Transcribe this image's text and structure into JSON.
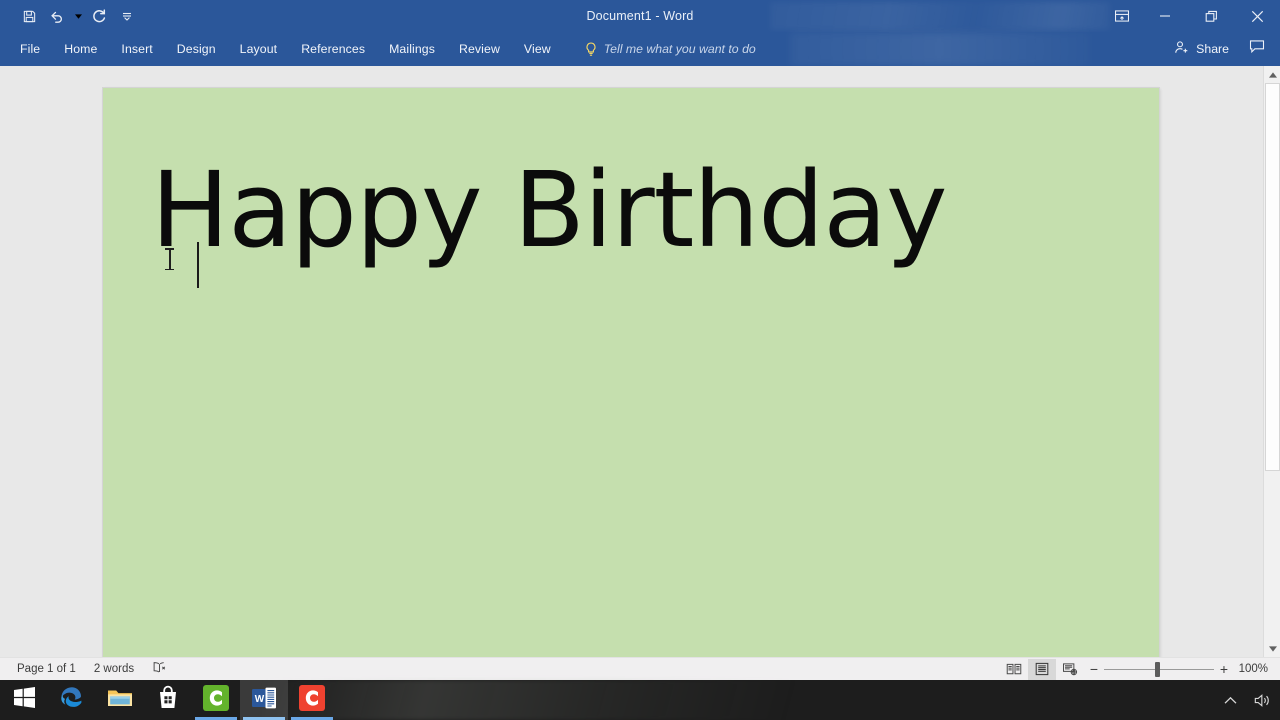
{
  "window": {
    "title": "Document1  -  Word",
    "quick_access": [
      {
        "name": "save",
        "label": "Save",
        "icon": "save-icon"
      },
      {
        "name": "undo",
        "label": "Undo",
        "icon": "undo-icon"
      },
      {
        "name": "redo",
        "label": "Redo",
        "icon": "redo-icon"
      },
      {
        "name": "customize-qat",
        "label": "Customize Quick Access Toolbar",
        "icon": "chevron-down-icon"
      }
    ],
    "controls": [
      {
        "name": "ribbon-display-options",
        "label": "Ribbon Display Options",
        "icon": "ribbon-options-icon"
      },
      {
        "name": "minimize",
        "label": "Minimize",
        "icon": "minimize-icon"
      },
      {
        "name": "restore",
        "label": "Restore Down",
        "icon": "restore-icon"
      },
      {
        "name": "close",
        "label": "Close",
        "icon": "close-icon"
      }
    ]
  },
  "ribbon": {
    "tabs": [
      {
        "label": "File"
      },
      {
        "label": "Home"
      },
      {
        "label": "Insert"
      },
      {
        "label": "Design"
      },
      {
        "label": "Layout"
      },
      {
        "label": "References"
      },
      {
        "label": "Mailings"
      },
      {
        "label": "Review"
      },
      {
        "label": "View"
      }
    ],
    "tell_me": {
      "label": "Tell me what you want to do",
      "icon": "lightbulb-icon"
    },
    "share": {
      "label": "Share",
      "icon": "share-person-icon"
    },
    "comments": {
      "label": "Comments",
      "icon": "comment-icon"
    }
  },
  "document": {
    "body_text": "Happy Birthday",
    "page_color": "#c5dfae",
    "text_color": "#0b0b0b"
  },
  "status_bar": {
    "page_info": "Page 1 of 1",
    "word_count": "2 words",
    "proofing": {
      "label": "Proofing errors / Spelling and Grammar Check",
      "icon": "proofing-icon"
    },
    "views": [
      {
        "name": "read-mode",
        "label": "Read Mode",
        "icon": "read-mode-icon",
        "active": false
      },
      {
        "name": "print-layout",
        "label": "Print Layout",
        "icon": "print-layout-icon",
        "active": true
      },
      {
        "name": "web-layout",
        "label": "Web Layout",
        "icon": "web-layout-icon",
        "active": false
      }
    ],
    "zoom": {
      "out_label": "−",
      "in_label": "+",
      "level": "100%"
    }
  },
  "taskbar": {
    "items": [
      {
        "name": "start",
        "label": "Start",
        "icon": "windows-logo-icon",
        "running": false,
        "active": false
      },
      {
        "name": "edge",
        "label": "Microsoft Edge",
        "icon": "edge-icon",
        "running": false,
        "active": false
      },
      {
        "name": "file-explorer",
        "label": "File Explorer",
        "icon": "folder-icon",
        "running": false,
        "active": false
      },
      {
        "name": "store",
        "label": "Microsoft Store",
        "icon": "store-bag-icon",
        "running": false,
        "active": false
      },
      {
        "name": "camtasia-studio",
        "label": "Camtasia Studio",
        "icon": "green-c-icon",
        "running": true,
        "active": false
      },
      {
        "name": "word",
        "label": "Word - Document1",
        "icon": "word-icon",
        "running": true,
        "active": true
      },
      {
        "name": "camtasia-recorder",
        "label": "Camtasia Recorder",
        "icon": "red-c-icon",
        "running": true,
        "active": false
      }
    ],
    "tray": [
      {
        "name": "show-hidden-icons",
        "label": "Show hidden icons",
        "icon": "chevron-up-icon"
      },
      {
        "name": "volume",
        "label": "Volume",
        "icon": "speaker-icon"
      }
    ]
  }
}
